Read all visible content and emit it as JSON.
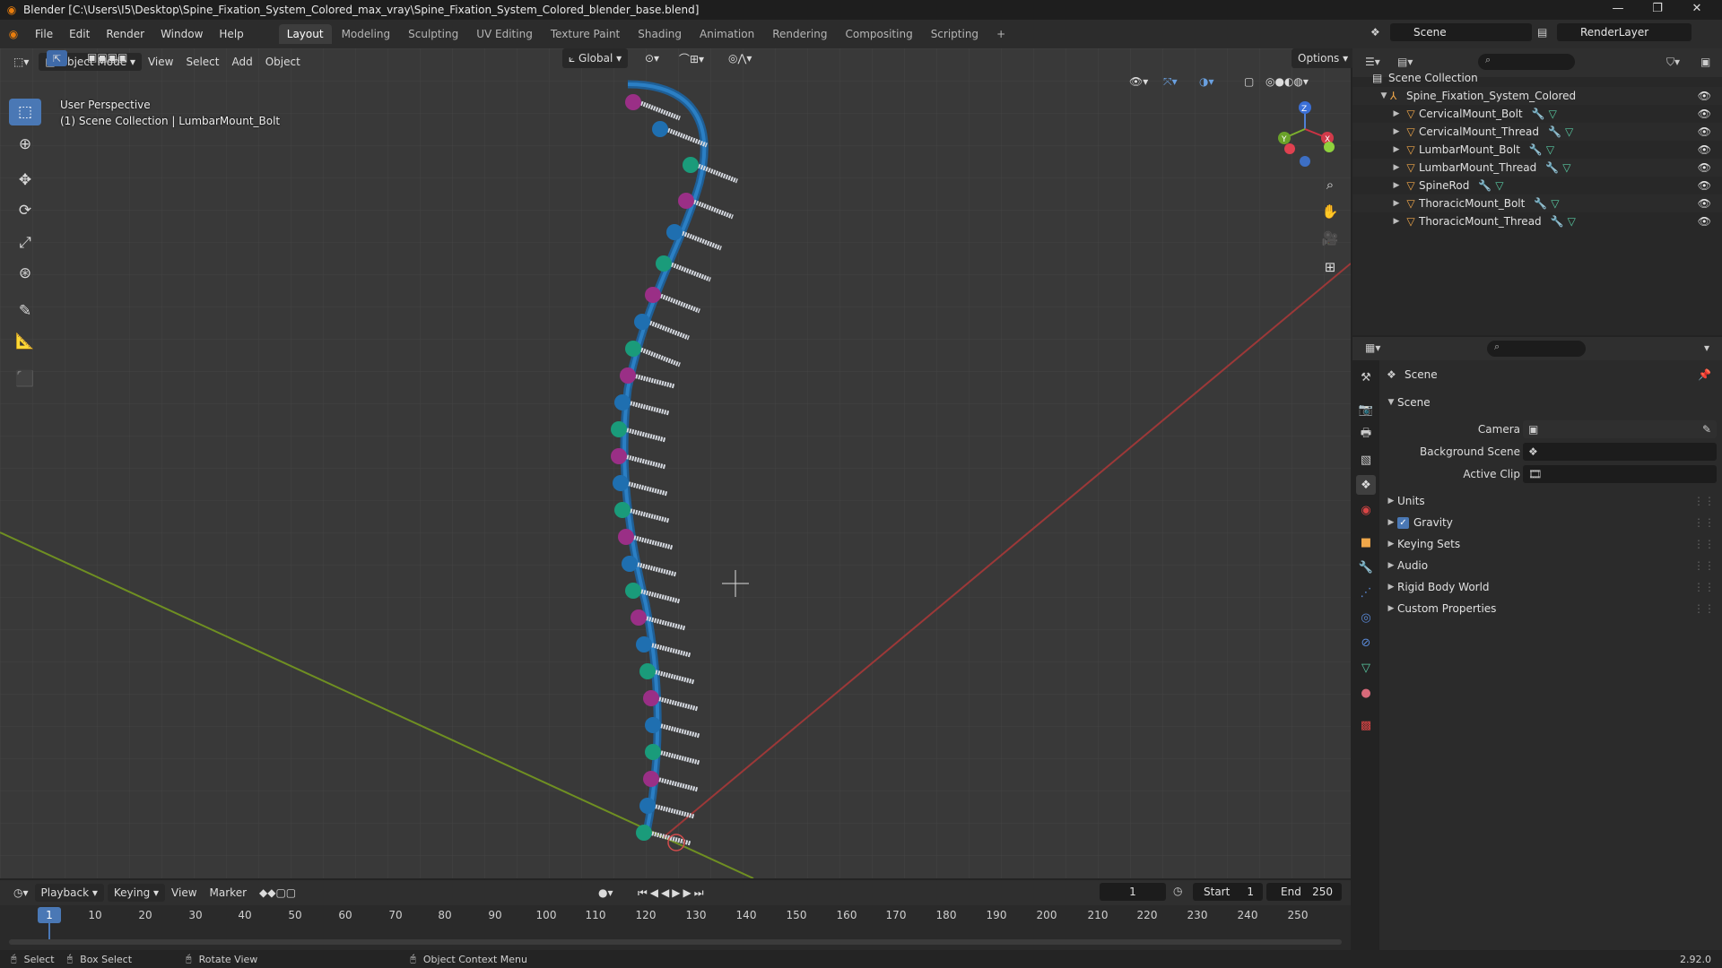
{
  "window": {
    "title": "Blender [C:\\Users\\I5\\Desktop\\Spine_Fixation_System_Colored_max_vray\\Spine_Fixation_System_Colored_blender_base.blend]",
    "minimize": "—",
    "maximize": "❐",
    "close": "✕"
  },
  "menus": [
    "File",
    "Edit",
    "Render",
    "Window",
    "Help"
  ],
  "workspaces": [
    "Layout",
    "Modeling",
    "Sculpting",
    "UV Editing",
    "Texture Paint",
    "Shading",
    "Animation",
    "Rendering",
    "Compositing",
    "Scripting",
    "+"
  ],
  "top_right": {
    "scene": "Scene",
    "view_layer": "RenderLayer"
  },
  "viewport": {
    "mode": "Object Mode",
    "menus": [
      "View",
      "Select",
      "Add",
      "Object"
    ],
    "transform_orientation": "Global",
    "options": "Options",
    "overlay_title": "User Perspective",
    "overlay_subtitle": "(1) Scene Collection | LumbarMount_Bolt",
    "gizmo": {
      "x": "X",
      "y": "Y",
      "z": "Z"
    }
  },
  "outliner": {
    "root": "Scene Collection",
    "collection": "Spine_Fixation_System_Colored",
    "items": [
      {
        "name": "CervicalMount_Bolt"
      },
      {
        "name": "CervicalMount_Thread"
      },
      {
        "name": "LumbarMount_Bolt"
      },
      {
        "name": "LumbarMount_Thread"
      },
      {
        "name": "SpineRod"
      },
      {
        "name": "ThoracicMount_Bolt"
      },
      {
        "name": "ThoracicMount_Thread"
      }
    ]
  },
  "properties": {
    "context": "Scene",
    "panel": "Scene",
    "camera_label": "Camera",
    "background_label": "Background Scene",
    "clip_label": "Active Clip",
    "sections": [
      "Units",
      "Gravity",
      "Keying Sets",
      "Audio",
      "Rigid Body World",
      "Custom Properties"
    ],
    "gravity_checked": true
  },
  "timeline": {
    "menus": [
      "Playback",
      "Keying",
      "View",
      "Marker"
    ],
    "current_frame": "1",
    "start_label": "Start",
    "start": "1",
    "end_label": "End",
    "end": "250",
    "ticks": [
      "1",
      "10",
      "20",
      "30",
      "40",
      "50",
      "60",
      "70",
      "80",
      "90",
      "100",
      "110",
      "120",
      "130",
      "140",
      "150",
      "160",
      "170",
      "180",
      "190",
      "200",
      "210",
      "220",
      "230",
      "240",
      "250"
    ]
  },
  "statusbar": {
    "select": "Select",
    "box_select": "Box Select",
    "rotate": "Rotate View",
    "context_menu": "Object Context Menu",
    "version": "2.92.0"
  },
  "colors": {
    "accent": "#4a78b5",
    "rod": "#1f6fb0",
    "teal": "#1a9b7a",
    "magenta": "#9a2f86",
    "screw": "#d4d8df"
  }
}
